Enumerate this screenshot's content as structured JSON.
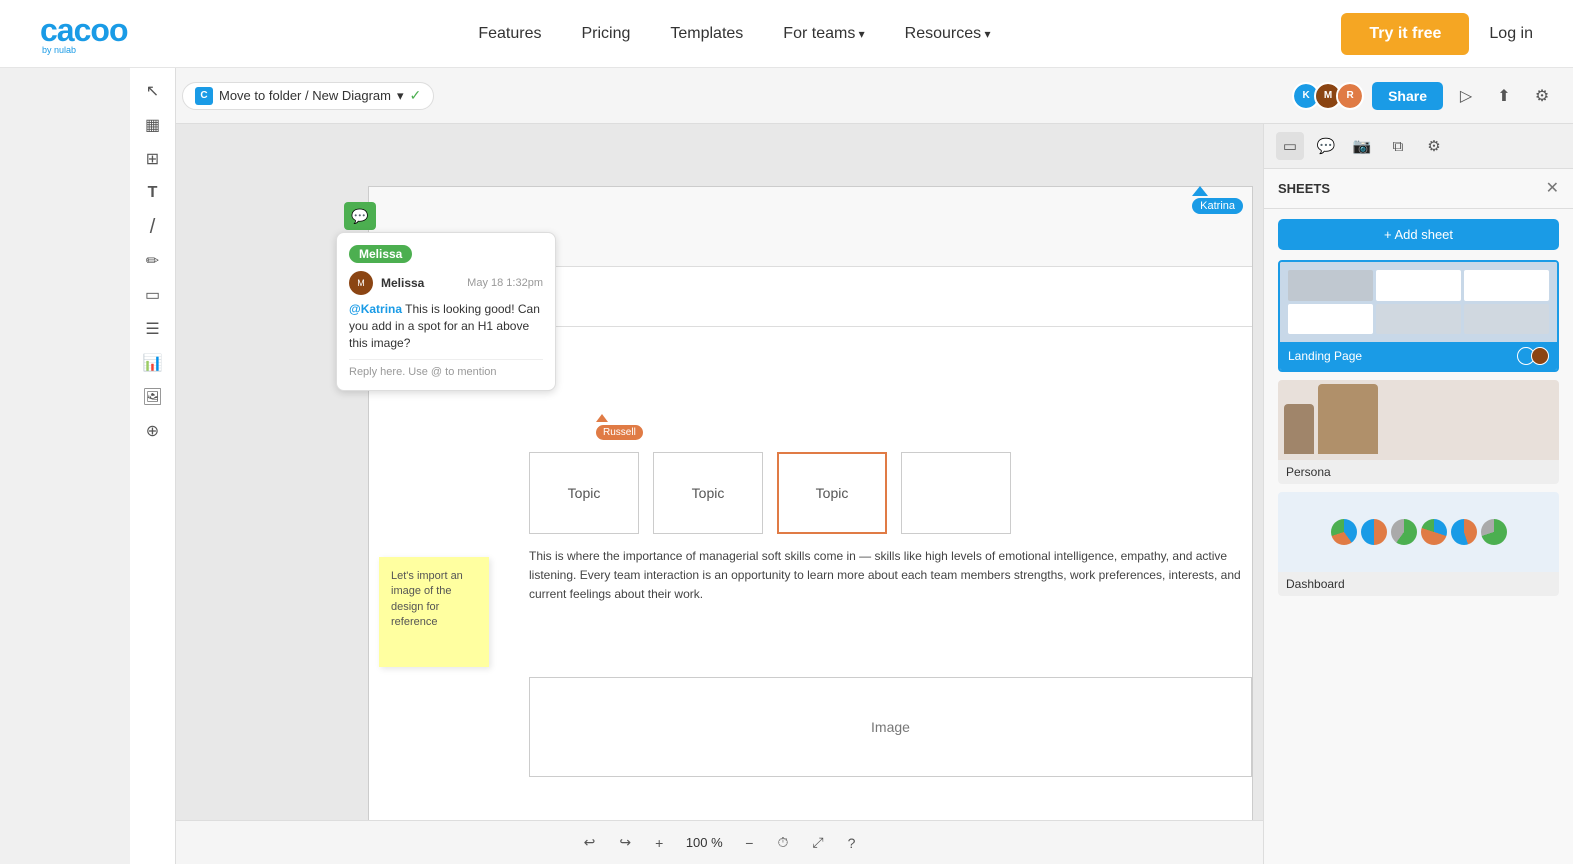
{
  "nav": {
    "logo": "cacoo",
    "logo_sub": "by nulab",
    "links": [
      {
        "label": "Features",
        "arrow": false
      },
      {
        "label": "Pricing",
        "arrow": false
      },
      {
        "label": "Templates",
        "arrow": false
      },
      {
        "label": "For teams",
        "arrow": true
      },
      {
        "label": "Resources",
        "arrow": true
      }
    ],
    "try_free": "Try it free",
    "login": "Log in"
  },
  "canvas": {
    "back_icon": "‹",
    "breadcrumb_icon": "C",
    "breadcrumb_text": "Move to folder / New Diagram",
    "breadcrumb_arrow": "▾",
    "check_icon": "✓",
    "share_label": "Share",
    "cursor_katrina_label": "Katrina",
    "cursor_russell_label": "Russell"
  },
  "comment": {
    "author_tag": "Melissa",
    "avatar_initials": "M",
    "name": "Melissa",
    "time": "May 18 1:32pm",
    "mention": "@Katrina",
    "body": " This is looking good! Can you add in a spot for an H1 above this image?",
    "reply_placeholder": "Reply here. Use @ to mention"
  },
  "diagram": {
    "topics": [
      "Topic",
      "Topic",
      "Topic"
    ],
    "body_text": "This is where the importance of managerial soft skills come in — skills like high levels of emotional intelligence, empathy, and active listening. Every team interaction is an opportunity to learn more about each team members strengths, work preferences, interests, and current feelings about their work.",
    "sticky_text": "Let's import an image of the design for reference",
    "image_label": "Image"
  },
  "sheets": {
    "title": "SHEETS",
    "add_label": "+ Add sheet",
    "close_icon": "✕",
    "sheets": [
      {
        "name": "Landing Page",
        "type": "landing"
      },
      {
        "name": "Persona",
        "type": "persona"
      },
      {
        "name": "Dashboard",
        "type": "dashboard"
      }
    ]
  },
  "toolbar_bottom": {
    "zoom": "100 %"
  },
  "icons": {
    "back": "‹",
    "undo": "↩",
    "redo": "↪",
    "plus": "+",
    "minus": "−",
    "history": "⏱",
    "help": "?",
    "cursor": "↖",
    "table": "▦",
    "grid": "⊞",
    "text": "T",
    "line": "/",
    "pencil": "✏",
    "frame": "▭",
    "list": "☰",
    "chart": "📊",
    "image": "🖼",
    "plugin": "⊕",
    "page_icon": "▭",
    "chat_icon": "💬",
    "video_icon": "📷",
    "settings_icon": "⚙"
  }
}
